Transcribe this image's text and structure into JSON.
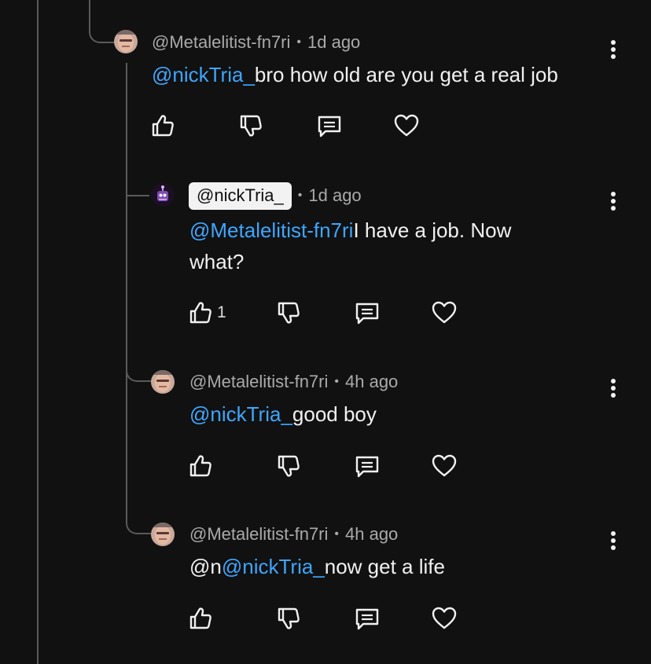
{
  "thread": {
    "comments": [
      {
        "handle": "@Metalelitist-fn7ri",
        "separator": "•",
        "time": "1d ago",
        "mention": "@nickTria_",
        "body": "bro how old are you get a real job",
        "like_count": "",
        "avatar": "photo-face-avatar"
      },
      {
        "handle": "@nickTria_",
        "separator": "•",
        "time": "1d ago",
        "mention": "@Metalelitist-fn7ri",
        "body_line1": "I have a job. Now",
        "body_line2": "what?",
        "like_count": "1",
        "avatar": "robot-avatar"
      },
      {
        "handle": "@Metalelitist-fn7ri",
        "separator": "•",
        "time": "4h ago",
        "mention": "@nickTria_",
        "body": "good boy",
        "like_count": "",
        "avatar": "photo-face-avatar"
      },
      {
        "handle": "@Metalelitist-fn7ri",
        "separator": "•",
        "time": "4h ago",
        "prefix": "@n",
        "mention": "@nickTria_",
        "body": "now get a life",
        "like_count": "",
        "avatar": "photo-face-avatar"
      }
    ]
  },
  "colors": {
    "background": "#111111",
    "mention": "#3ea6ff",
    "meta_text": "#aaaaaa",
    "body_text": "#f1f1f1",
    "owner_chip_bg": "#f2f2f2",
    "thread_line": "#5a5a5a"
  },
  "icons": {
    "like": "thumbs-up-icon",
    "dislike": "thumbs-down-icon",
    "reply": "reply-bubble-icon",
    "heart": "heart-icon",
    "more": "more-vertical-icon"
  }
}
